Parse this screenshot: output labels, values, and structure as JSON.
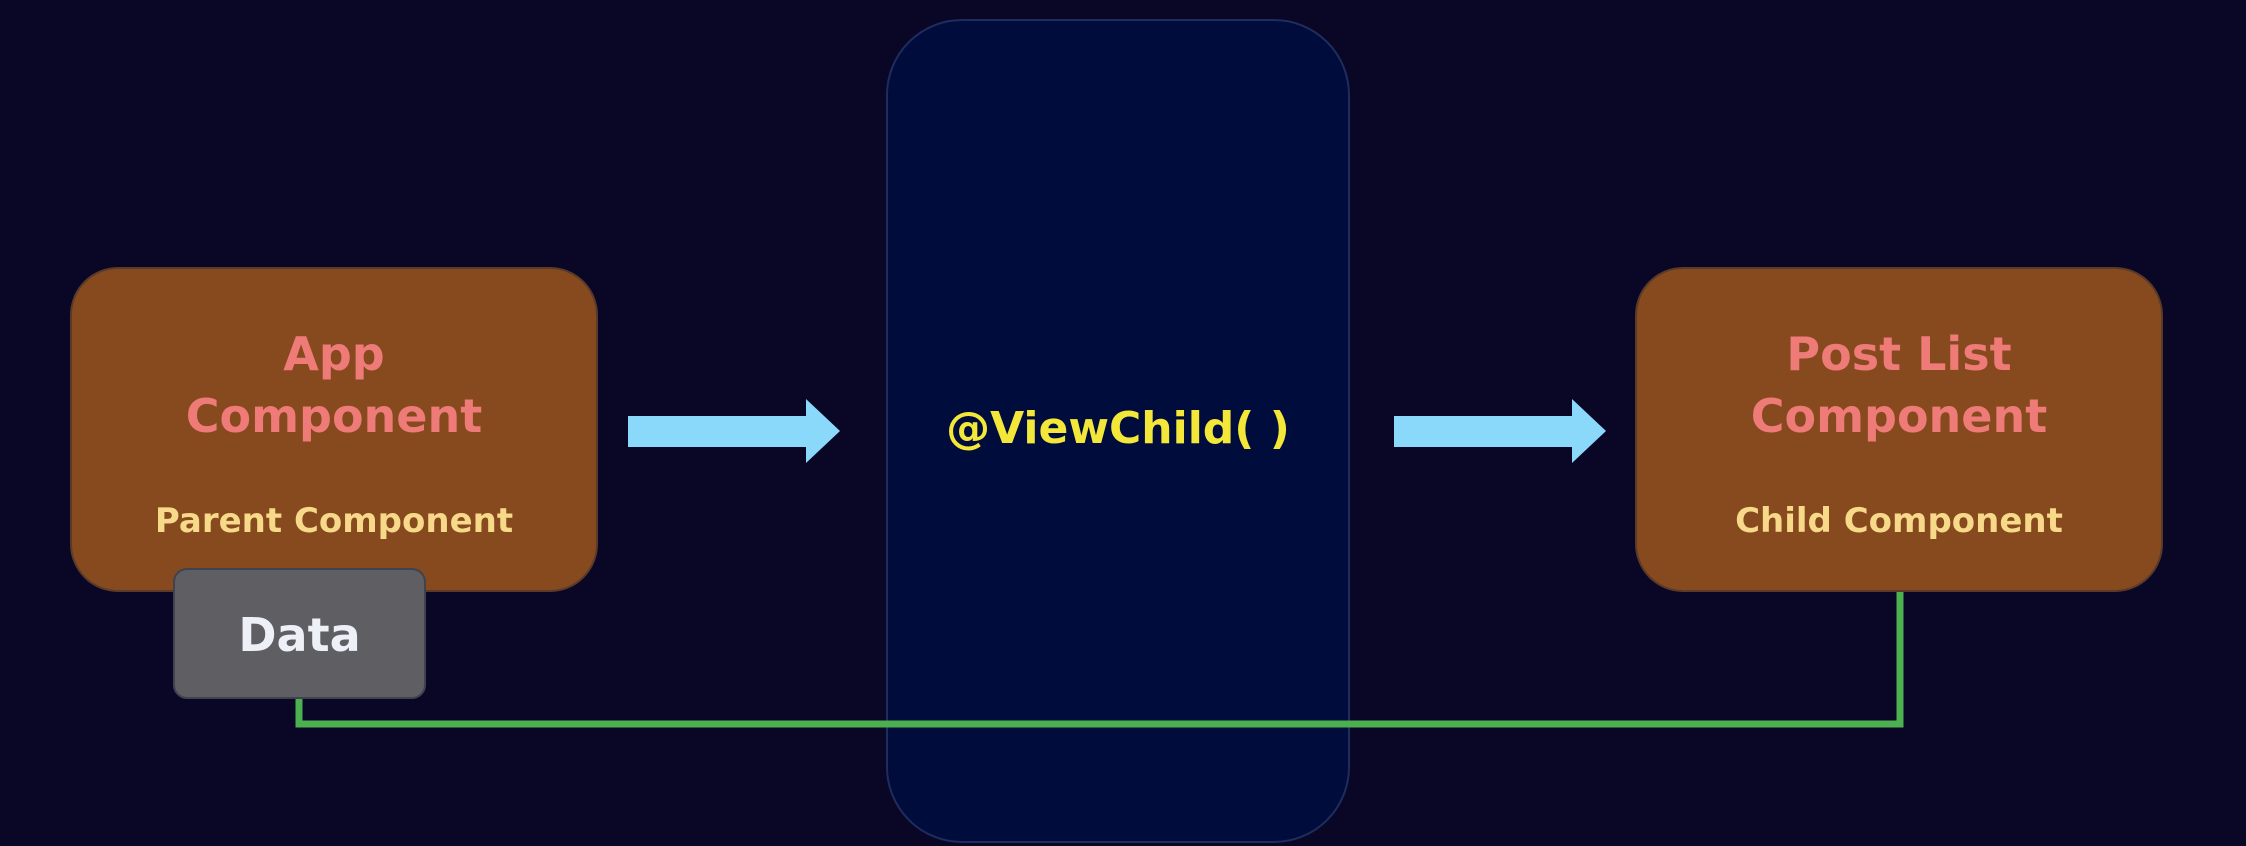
{
  "parent": {
    "title_line1": "App",
    "title_line2": "Component",
    "subtitle": "Parent Component"
  },
  "middle": {
    "label": "@ViewChild( )"
  },
  "child": {
    "title_line1": "Post List",
    "title_line2": "Component",
    "subtitle": "Child Component"
  },
  "data_box": {
    "label": "Data"
  },
  "colors": {
    "background": "#0a0726",
    "component_fill": "#874a1e",
    "component_title": "#ee7b78",
    "component_subtitle": "#f7d98a",
    "panel_fill": "#000c3c",
    "viewchild_text": "#f3e73a",
    "data_fill": "#5e5e63",
    "arrow": "#8ad9fb",
    "connector": "#4caf50"
  }
}
